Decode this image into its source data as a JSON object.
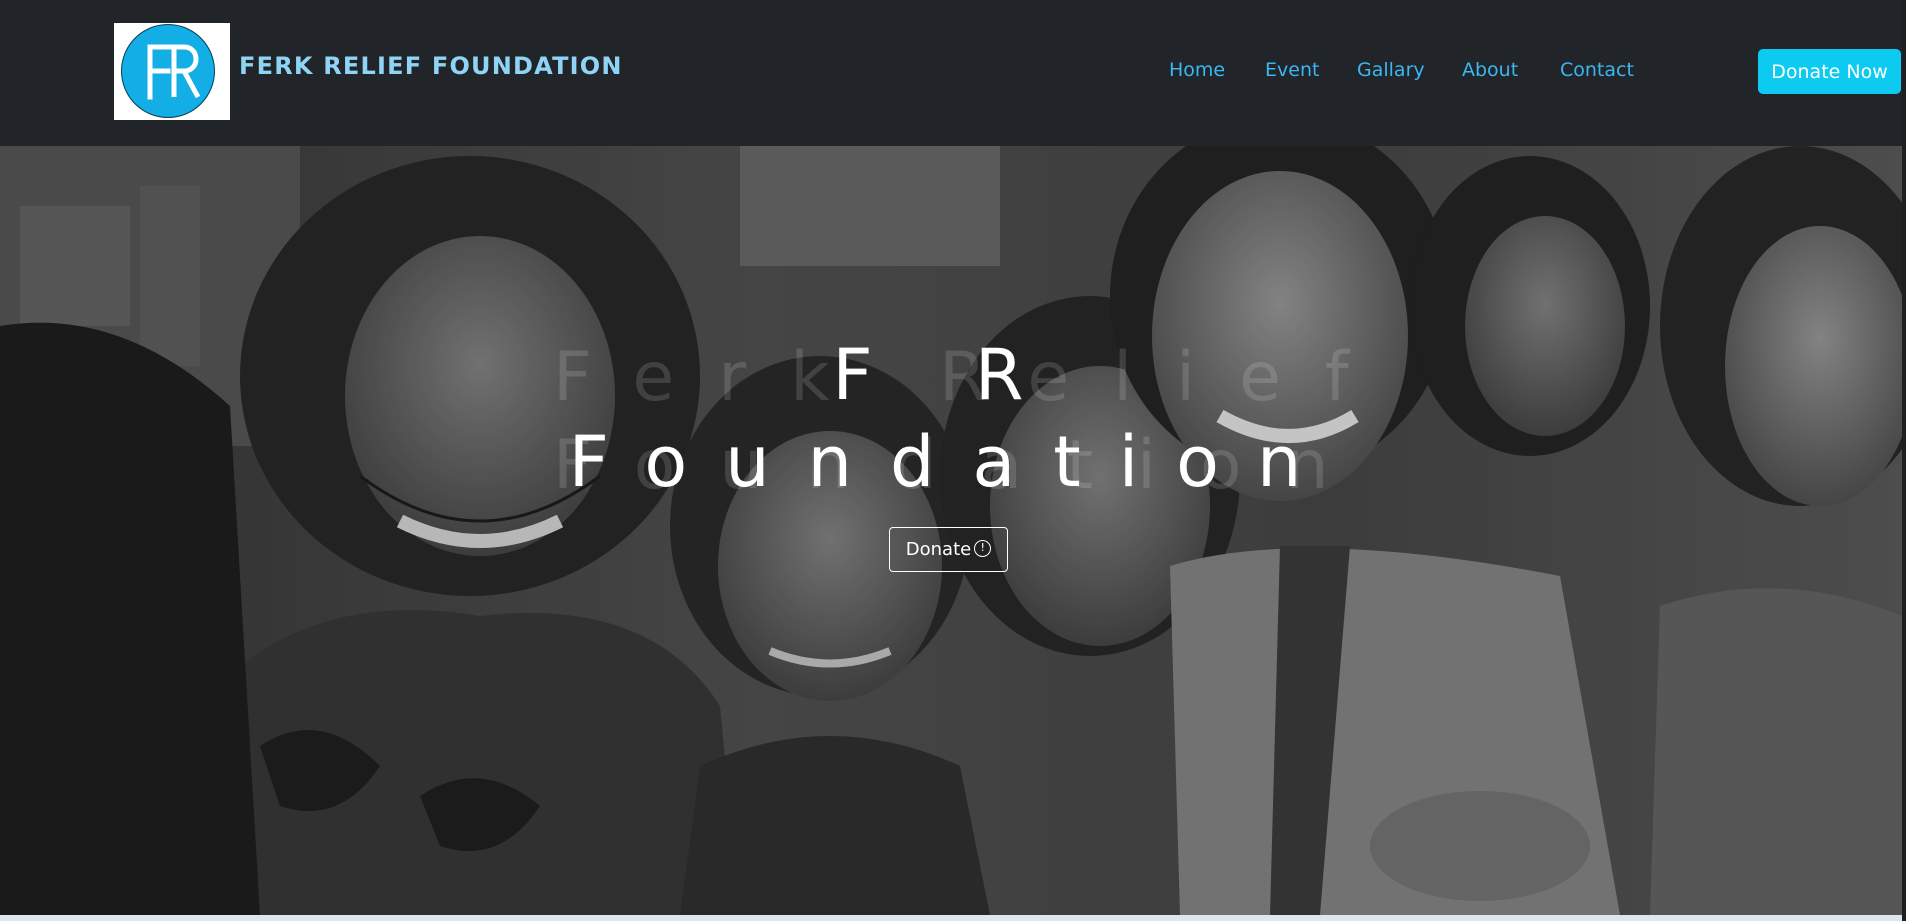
{
  "header": {
    "logo_text": "FR",
    "brand": "FERK RELIEF FOUNDATION",
    "nav": [
      {
        "label": "Home"
      },
      {
        "label": "Event"
      },
      {
        "label": "Gallary"
      },
      {
        "label": "About"
      },
      {
        "label": "Contact"
      }
    ],
    "donate_now_label": "Donate Now"
  },
  "hero": {
    "ghost_line1": "Ferk Relief",
    "ghost_line2": "Foundation",
    "title_line1": "F R",
    "title_line2": "Foundation",
    "donate_label": "Donate",
    "donate_icon": "!"
  },
  "colors": {
    "navbar_bg": "#212529",
    "brand_text": "#8fd3f5",
    "nav_link": "#3bb7f0",
    "accent": "#0dcaf0",
    "logo_circle": "#13aee6"
  }
}
